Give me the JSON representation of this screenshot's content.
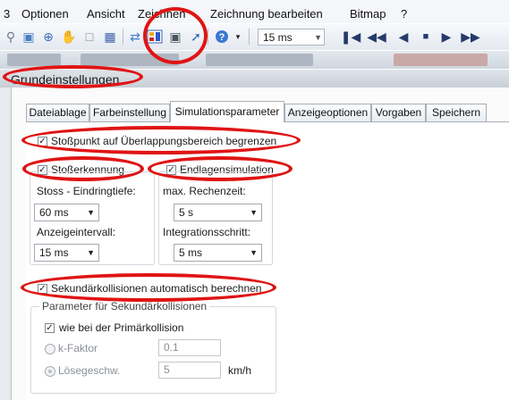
{
  "menu": [
    "3",
    "Optionen",
    "Ansicht",
    "Zeichnen",
    "Zeichnung bearbeiten",
    "Bitmap",
    "?"
  ],
  "toolbar": {
    "icons": [
      "zoom-rect-icon",
      "zoom-window-icon",
      "zoom-in-icon",
      "pan-hand-icon",
      "select-icon",
      "grid-icon",
      "arrows-icon",
      "color-bar-icon",
      "camera-icon",
      "line-icon",
      "help-icon",
      "dropdown-icon",
      "first-frame-icon",
      "prev-frame-icon",
      "step-back-icon",
      "stop-icon",
      "step-forward-icon",
      "next-frame-icon"
    ],
    "interval_value": "15 ms"
  },
  "panel_title": "Grundeinstellungen",
  "tabs": [
    "Dateiablage",
    "Farbeinstellung",
    "Simulationsparameter",
    "Anzeigeoptionen",
    "Vorgaben",
    "Speichern"
  ],
  "form": {
    "overlap_label": "Stoßpunkt auf Überlappungsbereich begrenzen",
    "collision_label": "Stoßerkennung",
    "endlagen_label": "Endlagensimulation",
    "depth_label": "Stoss - Eindringtiefe:",
    "depth_value": "60 ms",
    "rechenzeit_label": "max. Rechenzeit:",
    "rechenzeit_value": "5 s",
    "anzeige_label": "Anzeigeintervall:",
    "anzeige_value": "15 ms",
    "integration_label": "Integrationsschritt:",
    "integration_value": "5 ms",
    "secondary_label": "Sekundärkollisionen automatisch berechnen",
    "param_group_label": "Parameter für Sekundärkollisionen",
    "primary_label": "wie bei der Primärkollision",
    "kfactor_label": "k-Faktor",
    "kfactor_value": "0.1",
    "loese_label": "Lösegeschw.",
    "loese_value": "5",
    "loese_unit": "km/h"
  },
  "colors": {
    "highlight": "#e01414"
  }
}
